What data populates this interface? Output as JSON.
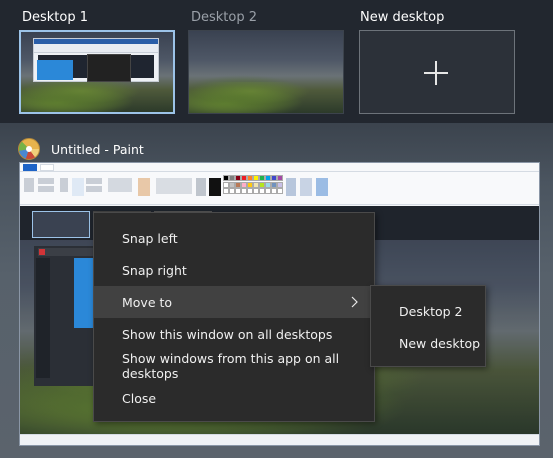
{
  "desktops": [
    {
      "label": "Desktop 1",
      "active": true
    },
    {
      "label": "Desktop 2",
      "active": false
    }
  ],
  "new_desktop": {
    "label": "New desktop",
    "icon": "plus-icon"
  },
  "window": {
    "title": "Untitled - Paint",
    "icon": "paint-icon"
  },
  "context_menu": {
    "items": [
      {
        "label": "Snap left"
      },
      {
        "label": "Snap right"
      },
      {
        "label": "Move to",
        "has_submenu": true,
        "highlighted": true
      },
      {
        "label": "Show this window on all desktops"
      },
      {
        "label": "Show windows from this app on all desktops"
      },
      {
        "label": "Close"
      }
    ]
  },
  "submenu": {
    "items": [
      {
        "label": "Desktop 2"
      },
      {
        "label": "New desktop"
      }
    ]
  },
  "colors": {
    "task_view_bg": "#22272f",
    "menu_bg": "#2b2b2b",
    "menu_highlight": "#414141",
    "active_desktop_border": "#9cc3e8"
  }
}
